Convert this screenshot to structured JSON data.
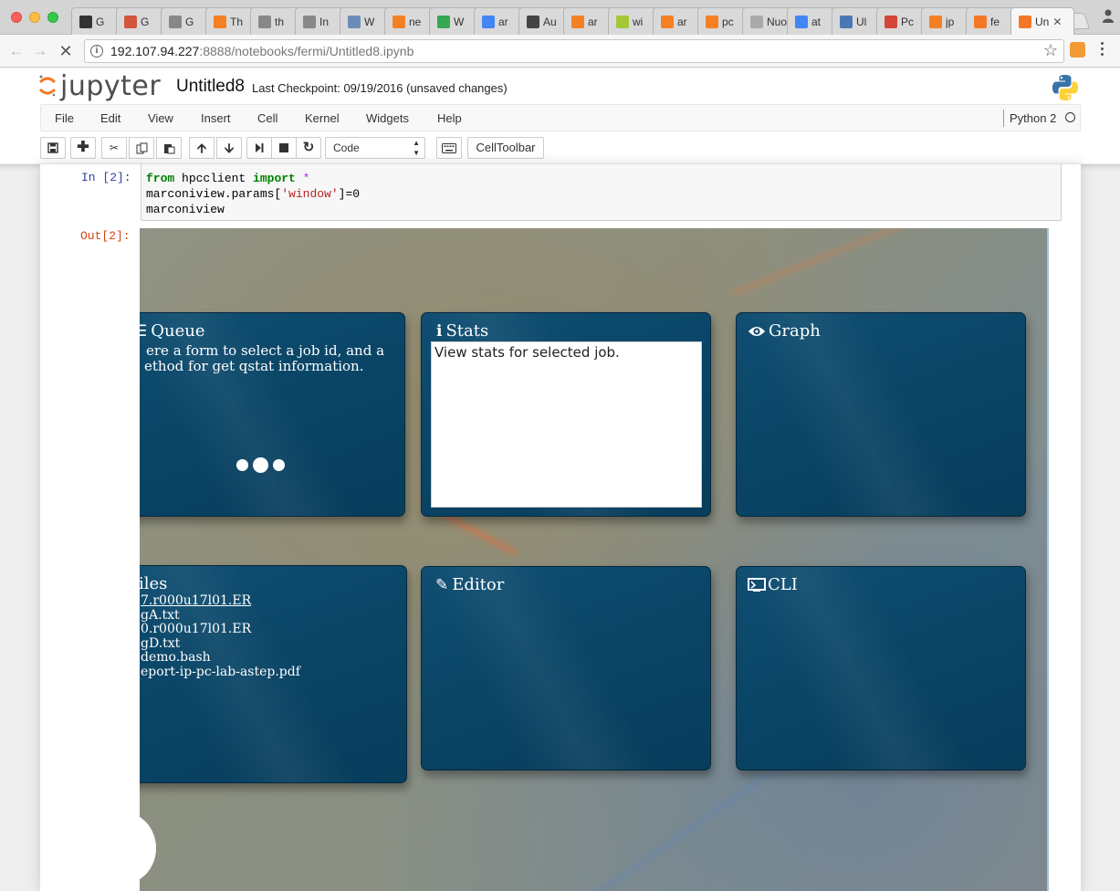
{
  "browser": {
    "tabs": [
      {
        "title": "G",
        "color": "#333333"
      },
      {
        "title": "G",
        "color": "#d2553e"
      },
      {
        "title": "G",
        "color": "#888888"
      },
      {
        "title": "Th",
        "color": "#f48024"
      },
      {
        "title": "th",
        "color": "#888888"
      },
      {
        "title": "In",
        "color": "#888888"
      },
      {
        "title": "W",
        "color": "#6b8cba"
      },
      {
        "title": "ne",
        "color": "#f48024"
      },
      {
        "title": "W",
        "color": "#34a853"
      },
      {
        "title": "ar",
        "color": "#4285f4"
      },
      {
        "title": "Au",
        "color": "#444444"
      },
      {
        "title": "ar",
        "color": "#f48024"
      },
      {
        "title": "wi",
        "color": "#a4c639"
      },
      {
        "title": "ar",
        "color": "#f48024"
      },
      {
        "title": "pc",
        "color": "#f48024"
      },
      {
        "title": "Nuov",
        "color": "#aaaaaa"
      },
      {
        "title": "at",
        "color": "#4285f4"
      },
      {
        "title": "Ul",
        "color": "#4a77b4"
      },
      {
        "title": "Pc",
        "color": "#d44638"
      },
      {
        "title": "jp",
        "color": "#f48024"
      },
      {
        "title": "fe",
        "color": "#f37726"
      },
      {
        "title": "Un",
        "color": "#f37726"
      }
    ],
    "url_host": "192.107.94.227",
    "url_path": ":8888/notebooks/fermi/Untitled8.ipynb"
  },
  "jupyter": {
    "logo_text": "jupyter",
    "notebook_name": "Untitled8",
    "checkpoint": "Last Checkpoint: 09/19/2016 (unsaved changes)",
    "menu": [
      "File",
      "Edit",
      "View",
      "Insert",
      "Cell",
      "Kernel",
      "Widgets",
      "Help"
    ],
    "kernel": "Python 2",
    "cell_type": "Code",
    "celltoolbar": "CellToolbar"
  },
  "cell": {
    "in_prompt": "In [2]:",
    "out_prompt": "Out[2]:",
    "code": {
      "line1_kw1": "from",
      "line1_mod": " hpcclient ",
      "line1_kw2": "import",
      "line1_star": " *",
      "line2_a": "marconiview.params[",
      "line2_str": "'window'",
      "line2_b": "]=0",
      "line3": "marconiview"
    }
  },
  "widget": {
    "queue": {
      "icon": "list-icon",
      "title": "Queue",
      "text1": "ere a form to select a job id, and a",
      "text2": "ethod for get qstat information."
    },
    "stats": {
      "icon": "info-icon",
      "title": "Stats",
      "text": "View stats for selected job."
    },
    "graph": {
      "icon": "eye-icon",
      "title": "Graph"
    },
    "files": {
      "title": "iles",
      "items": [
        "7.r000u17l01.ER",
        "gA.txt",
        "0.r000u17l01.ER",
        "gD.txt",
        "demo.bash",
        "eport-ip-pc-lab-astep.pdf"
      ]
    },
    "editor": {
      "icon": "pencil-icon",
      "title": "Editor"
    },
    "cli": {
      "icon": "terminal-icon",
      "title": "CLI"
    }
  }
}
